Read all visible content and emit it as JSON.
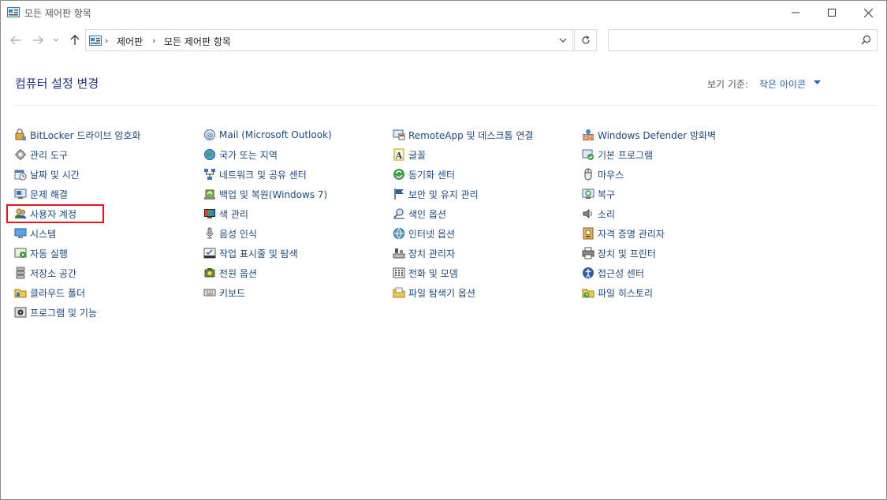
{
  "window": {
    "title": "모든 제어판 항목"
  },
  "address": {
    "segments": [
      "제어판",
      "모든 제어판 항목"
    ],
    "search_placeholder": ""
  },
  "header": {
    "title": "컴퓨터 설정 변경",
    "view_by_label": "보기 기준:",
    "view_by_value": "작은 아이콘"
  },
  "columns": [
    {
      "items": [
        {
          "label": "BitLocker 드라이브 암호화",
          "icon": "bitlocker-icon"
        },
        {
          "label": "관리 도구",
          "icon": "admin-tools-icon"
        },
        {
          "label": "날짜 및 시간",
          "icon": "date-time-icon"
        },
        {
          "label": "문제 해결",
          "icon": "troubleshoot-icon"
        },
        {
          "label": "사용자 계정",
          "icon": "user-accounts-icon"
        },
        {
          "label": "시스템",
          "icon": "system-icon"
        },
        {
          "label": "자동 실행",
          "icon": "autoplay-icon"
        },
        {
          "label": "저장소 공간",
          "icon": "storage-spaces-icon"
        },
        {
          "label": "클라우드 폴더",
          "icon": "work-folders-icon"
        },
        {
          "label": "프로그램 및 기능",
          "icon": "programs-features-icon"
        }
      ]
    },
    {
      "items": [
        {
          "label": "Mail (Microsoft Outlook)",
          "icon": "mail-icon"
        },
        {
          "label": "국가 또는 지역",
          "icon": "region-icon"
        },
        {
          "label": "네트워크 및 공유 센터",
          "icon": "network-icon"
        },
        {
          "label": "백업 및 복원(Windows 7)",
          "icon": "backup-icon"
        },
        {
          "label": "색 관리",
          "icon": "color-management-icon"
        },
        {
          "label": "음성 인식",
          "icon": "speech-icon"
        },
        {
          "label": "작업 표시줄 및 탐색",
          "icon": "taskbar-icon"
        },
        {
          "label": "전원 옵션",
          "icon": "power-icon"
        },
        {
          "label": "키보드",
          "icon": "keyboard-icon"
        }
      ]
    },
    {
      "items": [
        {
          "label": "RemoteApp 및 데스크톱 연결",
          "icon": "remoteapp-icon"
        },
        {
          "label": "글꼴",
          "icon": "fonts-icon"
        },
        {
          "label": "동기화 센터",
          "icon": "sync-icon"
        },
        {
          "label": "보안 및 유지 관리",
          "icon": "security-flag-icon"
        },
        {
          "label": "색인 옵션",
          "icon": "indexing-icon"
        },
        {
          "label": "인터넷 옵션",
          "icon": "internet-options-icon"
        },
        {
          "label": "장치 관리자",
          "icon": "device-manager-icon"
        },
        {
          "label": "전화 및 모뎀",
          "icon": "phone-modem-icon"
        },
        {
          "label": "파일 탐색기 옵션",
          "icon": "folder-options-icon"
        }
      ]
    },
    {
      "items": [
        {
          "label": "Windows Defender 방화벽",
          "icon": "firewall-icon"
        },
        {
          "label": "기본 프로그램",
          "icon": "default-programs-icon"
        },
        {
          "label": "마우스",
          "icon": "mouse-icon"
        },
        {
          "label": "복구",
          "icon": "recovery-icon"
        },
        {
          "label": "소리",
          "icon": "sound-icon"
        },
        {
          "label": "자격 증명 관리자",
          "icon": "credential-icon"
        },
        {
          "label": "장치 및 프린터",
          "icon": "printer-icon"
        },
        {
          "label": "접근성 센터",
          "icon": "ease-of-access-icon"
        },
        {
          "label": "파일 히스토리",
          "icon": "file-history-icon"
        }
      ]
    }
  ],
  "selected_item": "사용자 계정",
  "colors": {
    "link": "#1a4a87",
    "title": "#1e3287",
    "accent": "#1e64c8",
    "highlight": "#e8141e"
  }
}
